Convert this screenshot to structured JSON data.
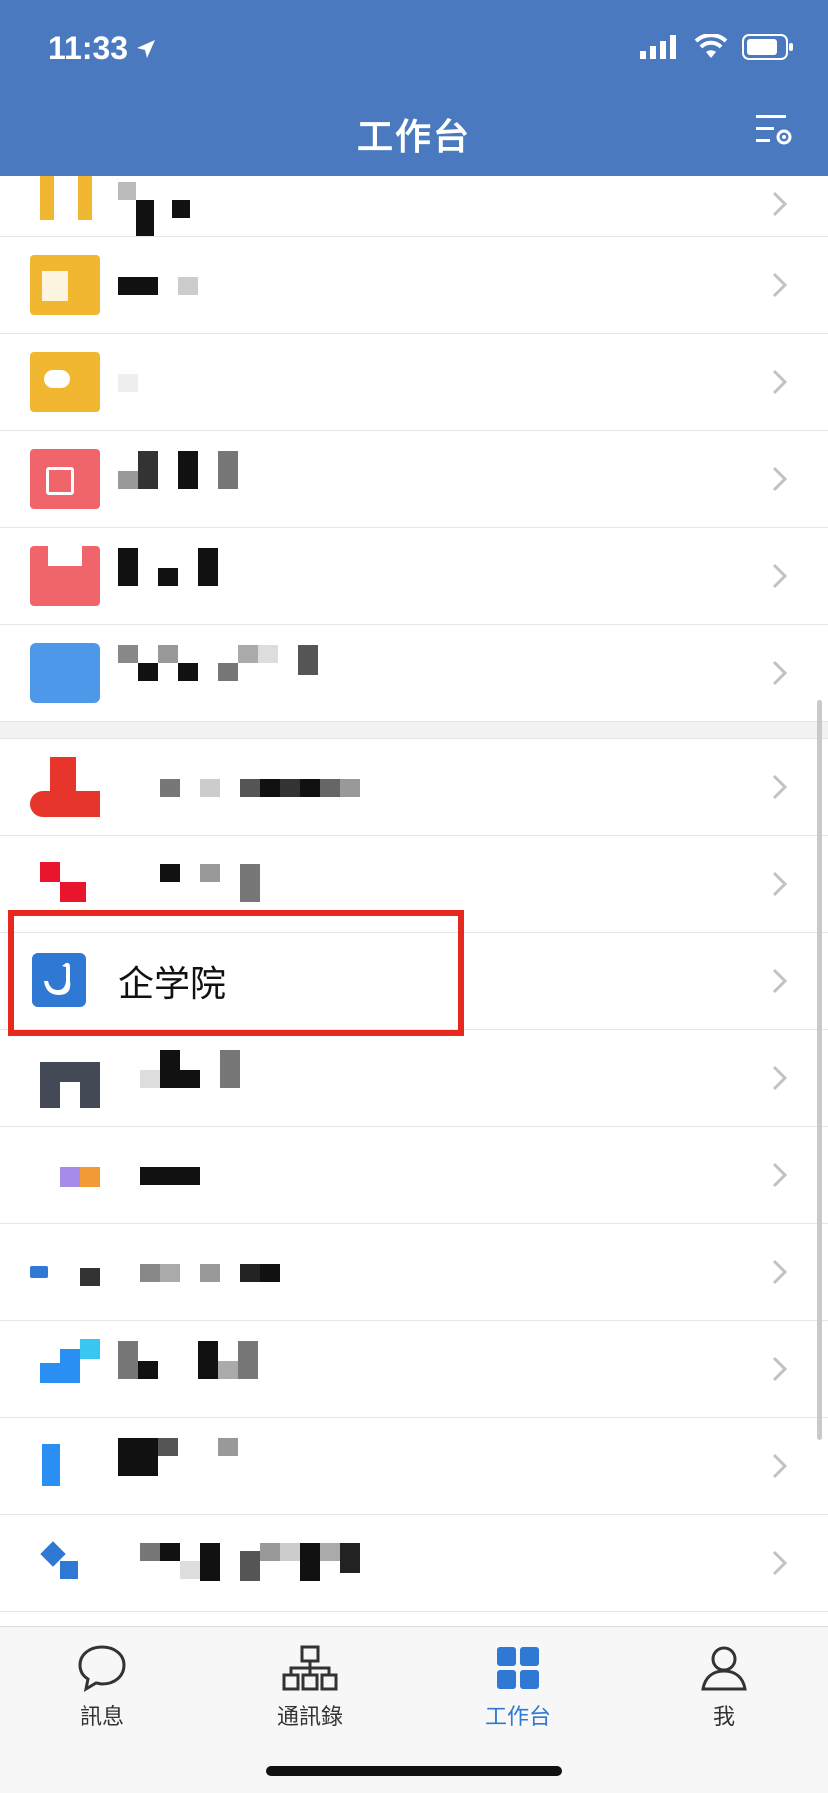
{
  "status": {
    "time": "11:33"
  },
  "header": {
    "title": "工作台"
  },
  "list": {
    "highlighted_app": "企学院"
  },
  "tabs": [
    {
      "label": "訊息",
      "icon": "chat-bubble-icon",
      "active": false
    },
    {
      "label": "通訊錄",
      "icon": "org-chart-icon",
      "active": false
    },
    {
      "label": "工作台",
      "icon": "grid-icon",
      "active": true
    },
    {
      "label": "我",
      "icon": "person-icon",
      "active": false
    }
  ],
  "colors": {
    "header": "#4a79bf",
    "accent": "#2f78d3",
    "highlight_border": "#e8281e",
    "qixueyuan_icon": "#2f78d3"
  }
}
